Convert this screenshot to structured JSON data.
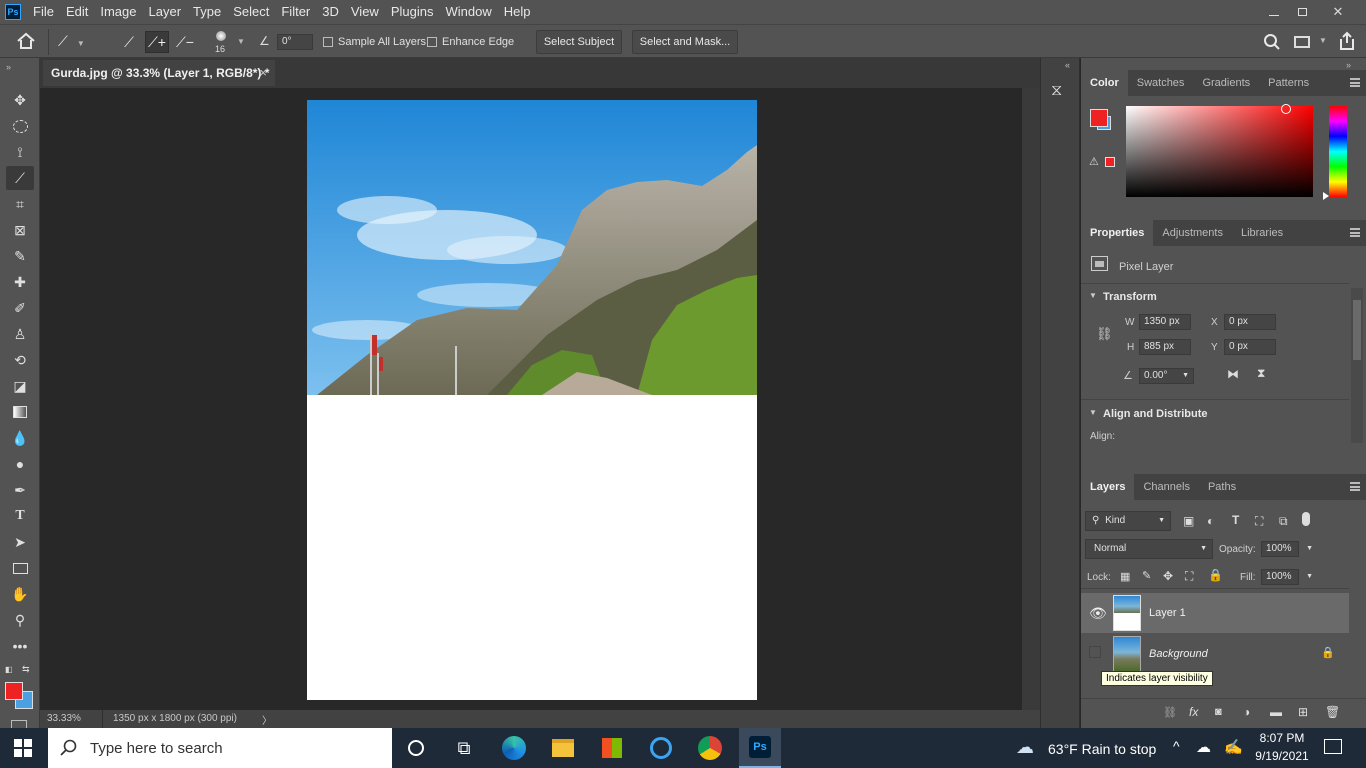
{
  "menubar": {
    "logo": "Ps",
    "items": [
      "File",
      "Edit",
      "Image",
      "Layer",
      "Type",
      "Select",
      "Filter",
      "3D",
      "View",
      "Plugins",
      "Window",
      "Help"
    ]
  },
  "options": {
    "brush_size": "16",
    "angle": "0°",
    "sample_all_layers": "Sample All Layers",
    "enhance_edge": "Enhance Edge",
    "select_subject": "Select Subject",
    "select_and_mask": "Select and Mask..."
  },
  "document": {
    "tab_title": "Gurda.jpg @ 33.3% (Layer 1, RGB/8*) *",
    "close": "×"
  },
  "status": {
    "zoom": "33.33%",
    "info": "1350 px x 1800 px (300 ppi)",
    "arrow": "〉"
  },
  "color_panel": {
    "tabs": [
      "Color",
      "Swatches",
      "Gradients",
      "Patterns"
    ],
    "foreground": "#ee2222",
    "background": "#4aa0e0"
  },
  "properties_panel": {
    "tabs": [
      "Properties",
      "Adjustments",
      "Libraries"
    ],
    "layer_type": "Pixel Layer",
    "transform_title": "Transform",
    "w_label": "W",
    "w_value": "1350 px",
    "x_label": "X",
    "x_value": "0 px",
    "h_label": "H",
    "h_value": "885 px",
    "y_label": "Y",
    "y_value": "0 px",
    "angle_value": "0.00°",
    "align_title": "Align and Distribute",
    "align_label": "Align:"
  },
  "layers_panel": {
    "tabs": [
      "Layers",
      "Channels",
      "Paths"
    ],
    "kind": "Kind",
    "blend_mode": "Normal",
    "opacity_label": "Opacity:",
    "opacity_value": "100%",
    "lock_label": "Lock:",
    "fill_label": "Fill:",
    "fill_value": "100%",
    "layers": [
      {
        "name": "Layer 1",
        "selected": true,
        "visible": true
      },
      {
        "name": "Background",
        "selected": false,
        "visible": false,
        "locked": true
      }
    ],
    "tooltip": "Indicates layer visibility"
  },
  "taskbar": {
    "search_placeholder": "Type here to search",
    "weather": "63°F  Rain to stop",
    "time": "8:07 PM",
    "date": "9/19/2021",
    "ps_label": "Ps"
  }
}
